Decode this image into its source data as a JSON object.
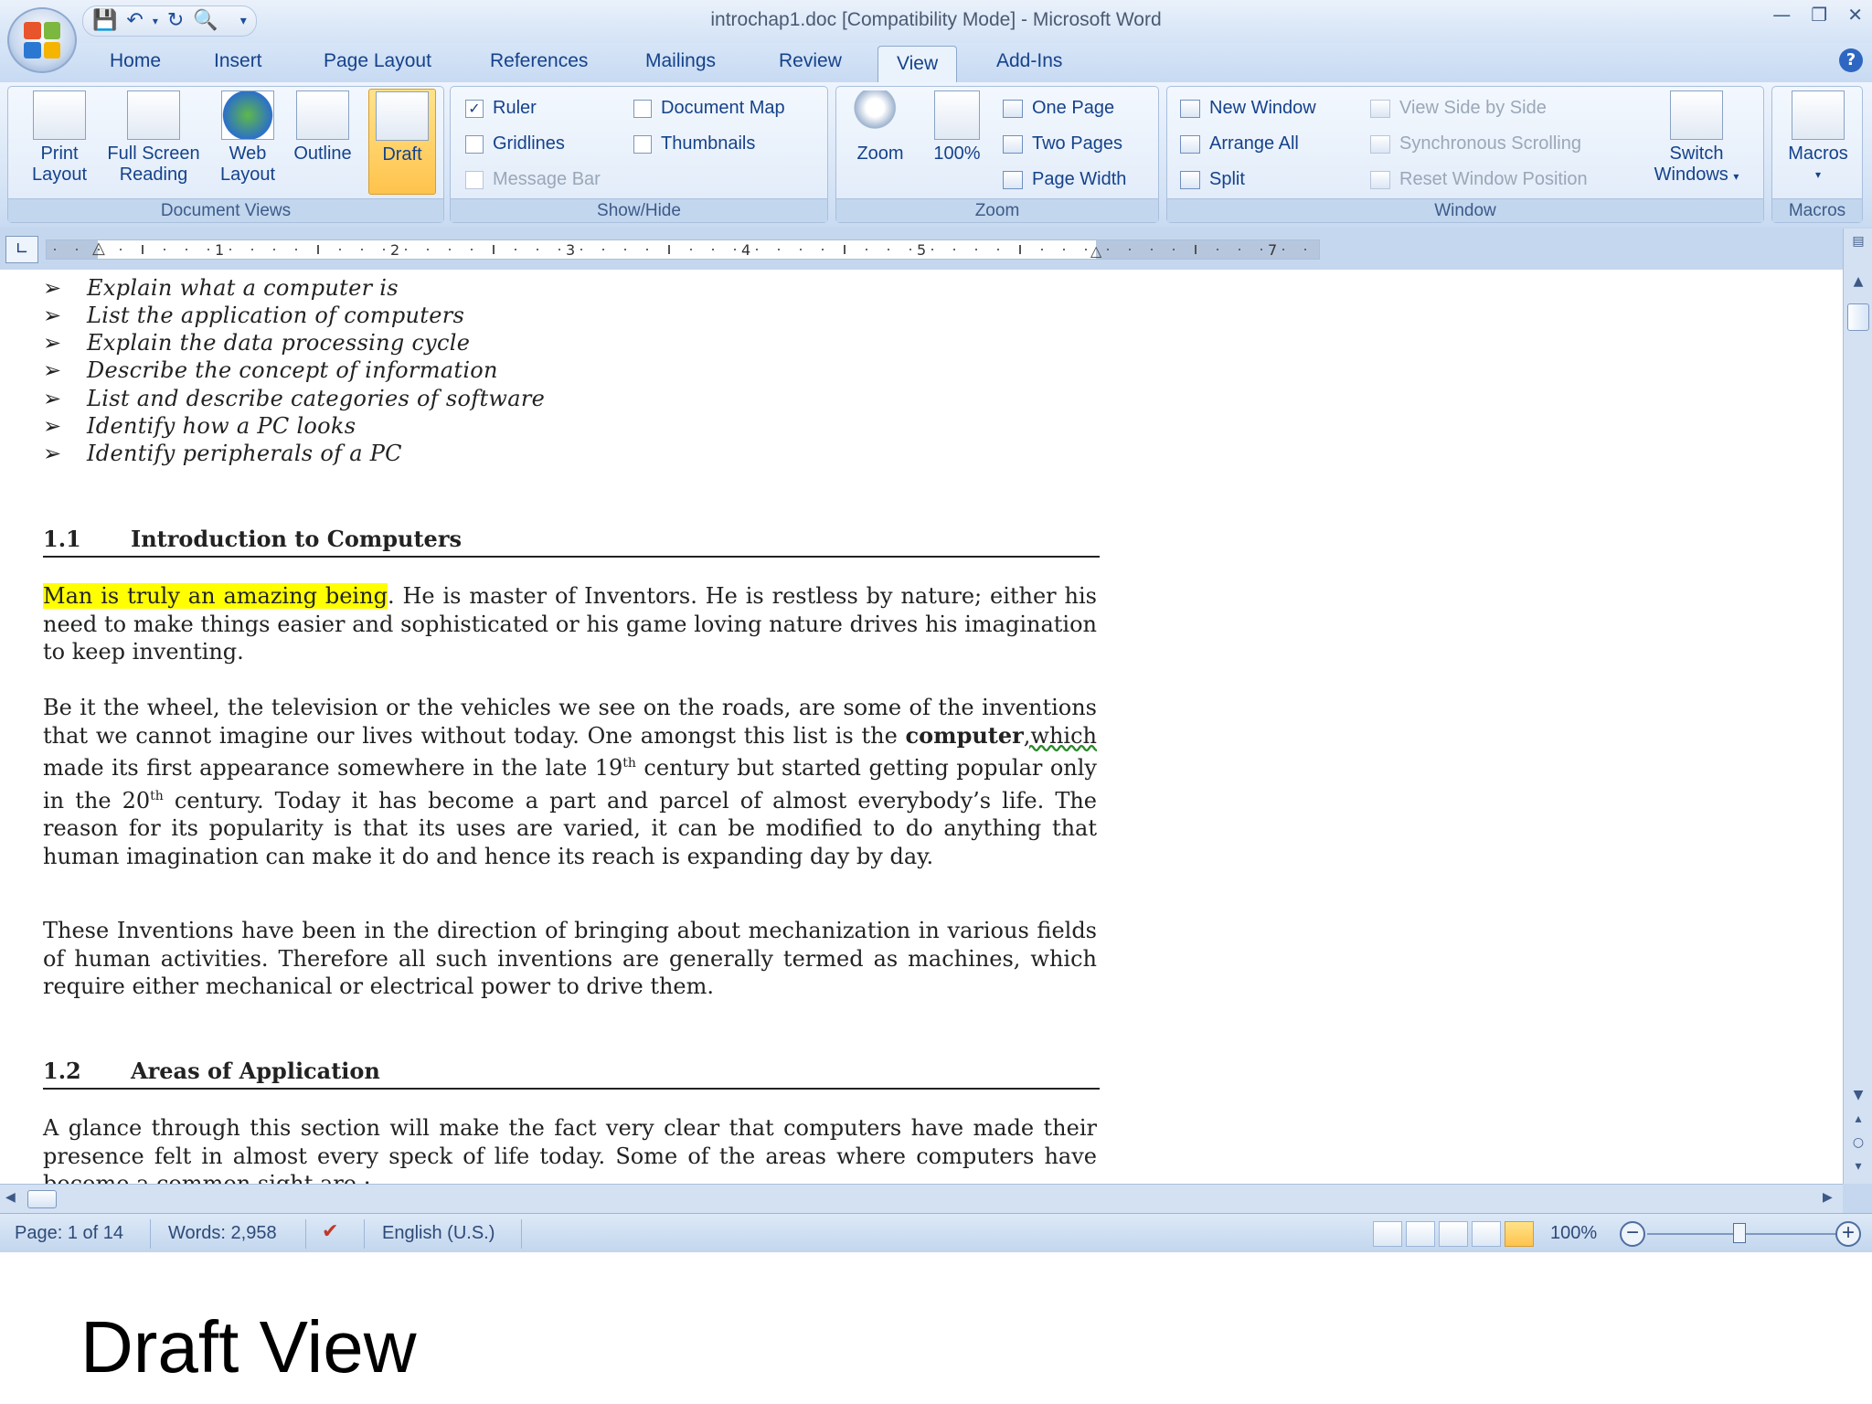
{
  "window": {
    "title": "introchap1.doc [Compatibility Mode] - Microsoft Word"
  },
  "tabs": [
    "Home",
    "Insert",
    "Page Layout",
    "References",
    "Mailings",
    "Review",
    "View",
    "Add-Ins"
  ],
  "active_tab": "View",
  "ribbon": {
    "document_views": {
      "label": "Document Views",
      "print_layout": [
        "Print",
        "Layout"
      ],
      "full_screen_reading": [
        "Full Screen",
        "Reading"
      ],
      "web_layout": [
        "Web",
        "Layout"
      ],
      "outline": "Outline",
      "draft": "Draft"
    },
    "show_hide": {
      "label": "Show/Hide",
      "ruler": "Ruler",
      "gridlines": "Gridlines",
      "message_bar": "Message Bar",
      "document_map": "Document Map",
      "thumbnails": "Thumbnails"
    },
    "zoom": {
      "label": "Zoom",
      "zoom": "Zoom",
      "hundred": "100%",
      "one_page": "One Page",
      "two_pages": "Two Pages",
      "page_width": "Page Width"
    },
    "window": {
      "label": "Window",
      "new_window": "New Window",
      "arrange_all": "Arrange All",
      "split": "Split",
      "view_side_by_side": "View Side by Side",
      "synchronous_scrolling": "Synchronous Scrolling",
      "reset_window_position": "Reset Window Position",
      "switch_windows": [
        "Switch",
        "Windows"
      ]
    },
    "macros": {
      "label": "Macros",
      "macros": "Macros"
    }
  },
  "ruler": {
    "numbers": [
      "1",
      "2",
      "3",
      "4",
      "5",
      "7"
    ]
  },
  "document": {
    "objectives": [
      "Explain what a computer is",
      "List the application of computers",
      "Explain the data processing cycle",
      "Describe the concept of information",
      "List and describe categories of software",
      "Identify how a PC looks",
      "Identify peripherals of a PC"
    ],
    "section1": {
      "number": "1.1",
      "title": "Introduction to Computers"
    },
    "p1_highlight": "Man is truly an amazing being",
    "p1_rest": ". He is master of Inventors. He is restless by nature; either his need to make things easier and sophisticated or his game loving nature drives his imagination to keep inventing.",
    "p2_a": "Be it the wheel, the television or the vehicles we see on the roads, are some of the inventions that we cannot imagine our lives without today. One amongst this list is the ",
    "p2_bold": "computer",
    "p2_b": ",which",
    "p2_c": " made its first appearance somewhere in the late 19",
    "p2_sup1": "th",
    "p2_d": " century but started getting popular only in the 20",
    "p2_sup2": "th",
    "p2_e": " century.  Today it has become a part and parcel of almost everybody’s life. The reason for its popularity is that its uses are varied, it can be modified to do anything that human imagination can make it do and hence its reach is expanding day by day.",
    "p3": "These Inventions have been in the direction of bringing about mechanization  in various fields of human activities. Therefore all such inventions are generally termed as machines, which require either mechanical or electrical power to drive them.",
    "section2": {
      "number": "1.2",
      "title": "Areas of Application"
    },
    "p4": "A glance through this section will make the fact very clear that computers have made their presence felt in almost every speck of life today. Some of the areas where computers have become a common sight are :"
  },
  "status": {
    "page": "Page: 1 of 14",
    "words": "Words: 2,958",
    "language": "English (U.S.)",
    "zoom": "100%"
  },
  "caption": "Draft View"
}
